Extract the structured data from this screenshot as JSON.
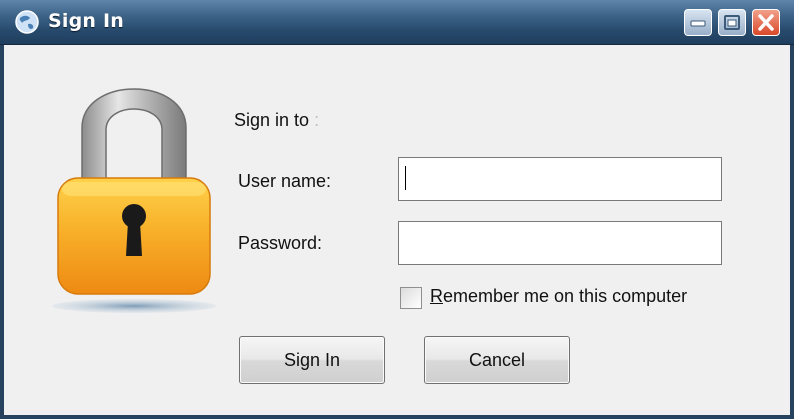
{
  "window": {
    "title": "Sign In",
    "title_icon": "globe-icon",
    "controls": [
      "minimize-icon",
      "maximize-icon",
      "close-icon"
    ]
  },
  "illustration": {
    "icon": "padlock-icon"
  },
  "form": {
    "sign_in_to_label": "Sign in to",
    "sign_in_to_colon": ":",
    "username_label": "User name:",
    "username_value": "",
    "password_label": "Password:",
    "password_value": "",
    "remember_label": "Remember me on this computer",
    "remember_checked": false
  },
  "buttons": {
    "sign_in": "Sign In",
    "cancel": "Cancel"
  },
  "colors": {
    "titlebar": "#274a6c",
    "lock_body": "#f5a623",
    "close_button": "#d9482a"
  }
}
